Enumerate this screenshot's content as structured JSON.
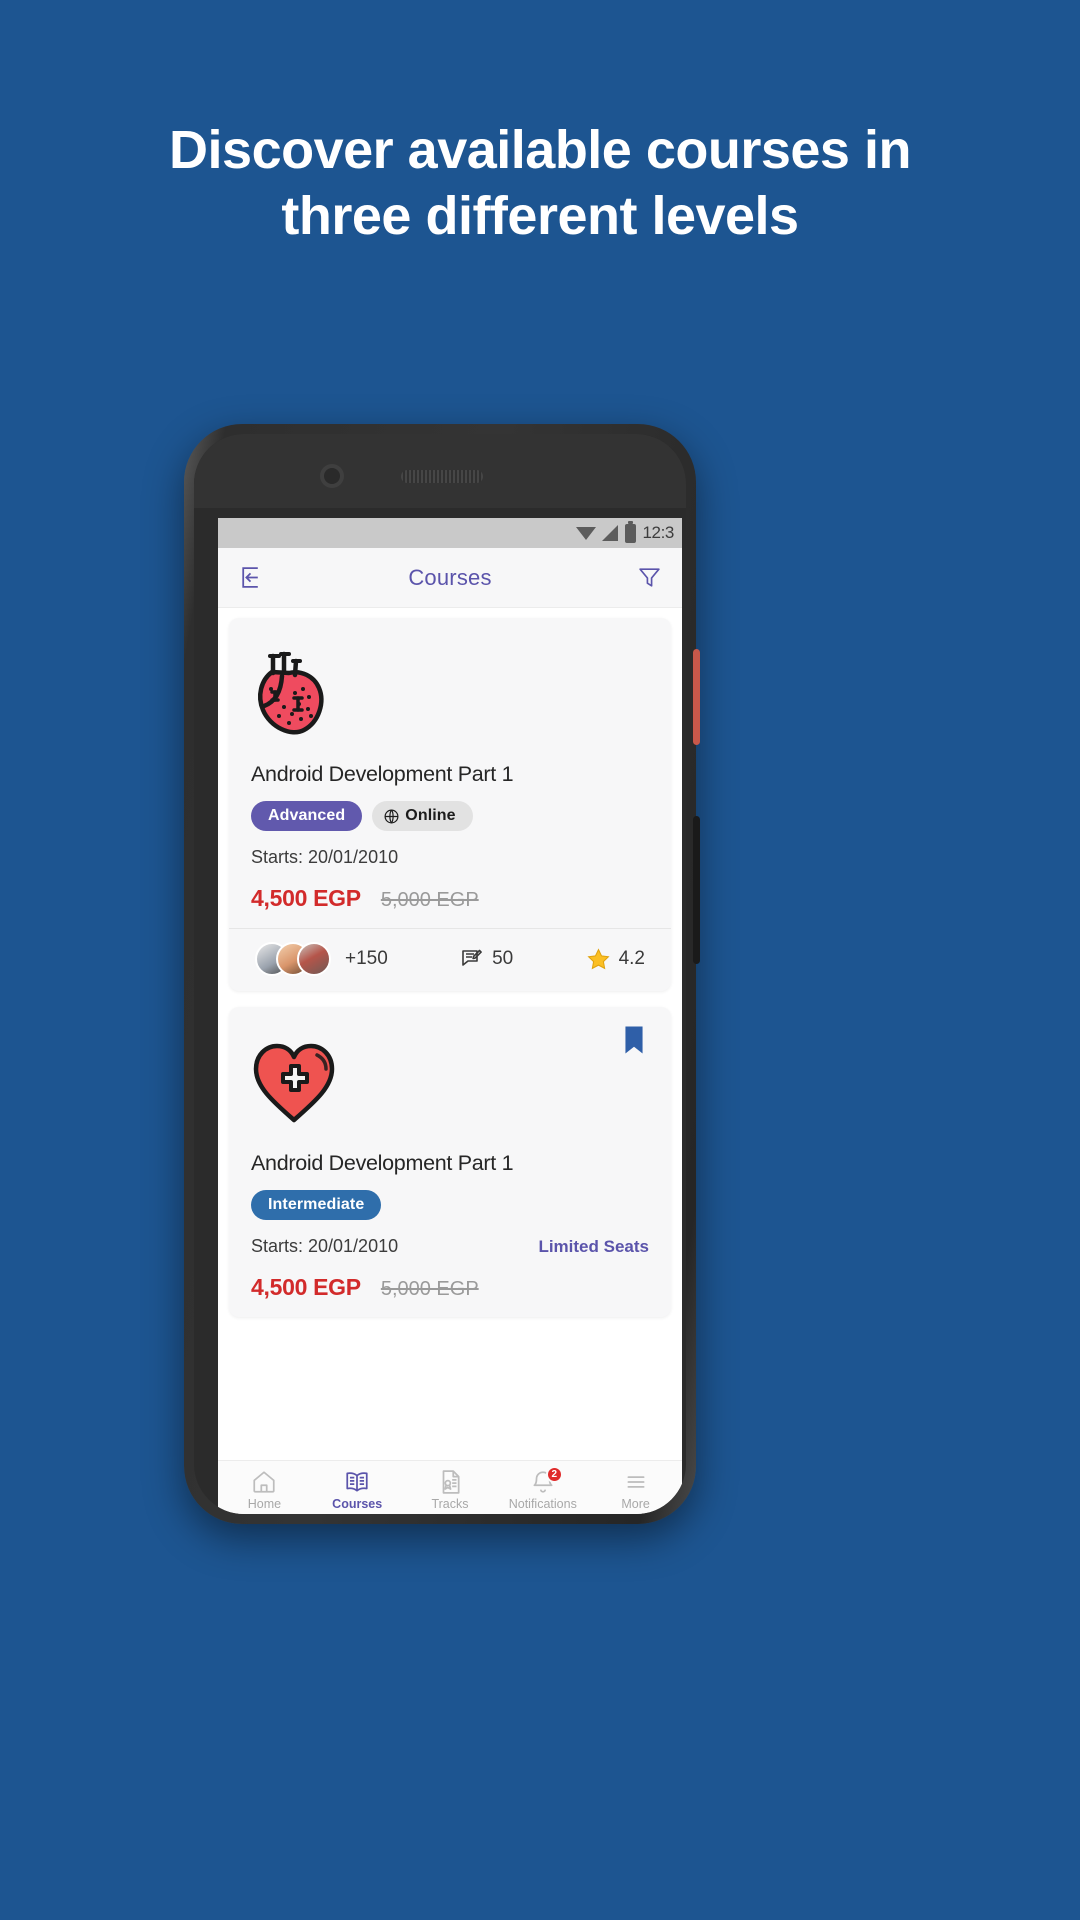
{
  "promo": {
    "headline_line1": "Discover available courses in",
    "headline_line2": "three different levels",
    "background_color": "#1d5591",
    "text_color": "#ffffff"
  },
  "phone": {
    "statusbar": {
      "time": "12:3",
      "icons": [
        "wifi-icon",
        "cellular-signal-icon",
        "battery-icon"
      ]
    },
    "appbar": {
      "back_icon": "back-arrow-box-icon",
      "title": "Courses",
      "filter_icon": "filter-funnel-icon",
      "accent_color": "#5b54ab"
    },
    "courses": [
      {
        "icon": "anatomical-heart-icon",
        "title": "Android Development Part 1",
        "level": "Advanced",
        "level_color": "#6159ad",
        "mode": "Online",
        "mode_icon": "globe-icon",
        "starts_label": "Starts: 20/01/2010",
        "limited_seats": "",
        "price_new": "4,500 EGP",
        "price_old": "5,000 EGP",
        "price_new_color": "#d22b2b",
        "footer": {
          "enrolled_count": "+150",
          "comments_icon": "comment-edit-icon",
          "comments_count": "50",
          "rating_icon": "star-icon",
          "rating": "4.2"
        },
        "bookmarked": false
      },
      {
        "icon": "heart-plus-icon",
        "title": "Android Development Part 1",
        "level": "Intermediate",
        "level_color": "#2f6eab",
        "mode": "",
        "mode_icon": "",
        "starts_label": "Starts: 20/01/2010",
        "limited_seats": "Limited Seats",
        "price_new": "4,500 EGP",
        "price_old": "5,000 EGP",
        "price_new_color": "#d22b2b",
        "bookmarked": true,
        "bookmark_icon": "bookmark-filled-icon",
        "bookmark_color": "#2f5fa8"
      }
    ],
    "bottom_nav": {
      "items": [
        {
          "label": "Home",
          "icon": "home-icon",
          "active": false,
          "badge": ""
        },
        {
          "label": "Courses",
          "icon": "open-book-icon",
          "active": true,
          "badge": ""
        },
        {
          "label": "Tracks",
          "icon": "certificate-icon",
          "active": false,
          "badge": ""
        },
        {
          "label": "Notifications",
          "icon": "bell-icon",
          "active": false,
          "badge": "2"
        },
        {
          "label": "More",
          "icon": "hamburger-menu-icon",
          "active": false,
          "badge": ""
        }
      ],
      "active_color": "#5b54ab",
      "inactive_color": "#a8a8a8",
      "badge_color": "#e02b2b"
    }
  }
}
